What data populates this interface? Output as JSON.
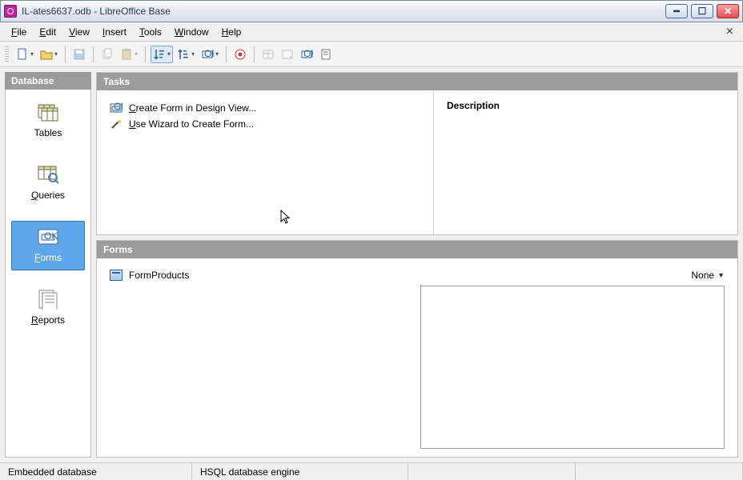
{
  "window": {
    "title": "IL-ates6637.odb - LibreOffice Base"
  },
  "menubar": {
    "file": "File",
    "edit": "Edit",
    "view": "View",
    "insert": "Insert",
    "tools": "Tools",
    "window": "Window",
    "help": "Help"
  },
  "sidebar": {
    "header": "Database",
    "items": {
      "tables": "Tables",
      "queries": "Queries",
      "forms": "Forms",
      "reports": "Reports"
    }
  },
  "tasks": {
    "header": "Tasks",
    "create_design": "Create Form in Design View...",
    "use_wizard": "Use Wizard to Create Form...",
    "description_label": "Description"
  },
  "forms": {
    "header": "Forms",
    "items": [
      "FormProducts"
    ],
    "view_mode": "None"
  },
  "statusbar": {
    "embedded": "Embedded database",
    "engine": "HSQL database engine"
  }
}
